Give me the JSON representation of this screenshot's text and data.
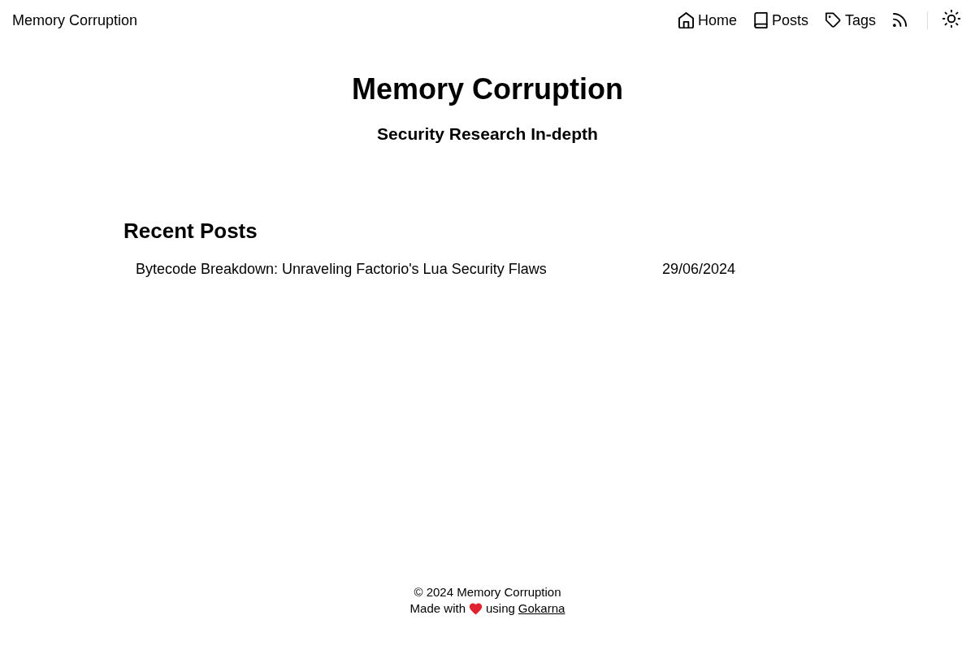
{
  "header": {
    "site_title": "Memory Corruption",
    "nav": [
      {
        "kind": "home",
        "label": "Home"
      },
      {
        "kind": "posts",
        "label": "Posts"
      },
      {
        "kind": "tags",
        "label": "Tags"
      },
      {
        "kind": "rss"
      }
    ]
  },
  "hero": {
    "title": "Memory Corruption",
    "subtitle": "Security Research In-depth"
  },
  "recent_posts": {
    "heading": "Recent Posts",
    "posts": [
      {
        "title": "Bytecode Breakdown: Unraveling Factorio's Lua Security Flaws",
        "date": "29/06/2024"
      }
    ]
  },
  "footer": {
    "copyright": "© 2024 Memory Corruption",
    "made_with": "Made with",
    "using": "using",
    "link": "Gokarna"
  }
}
